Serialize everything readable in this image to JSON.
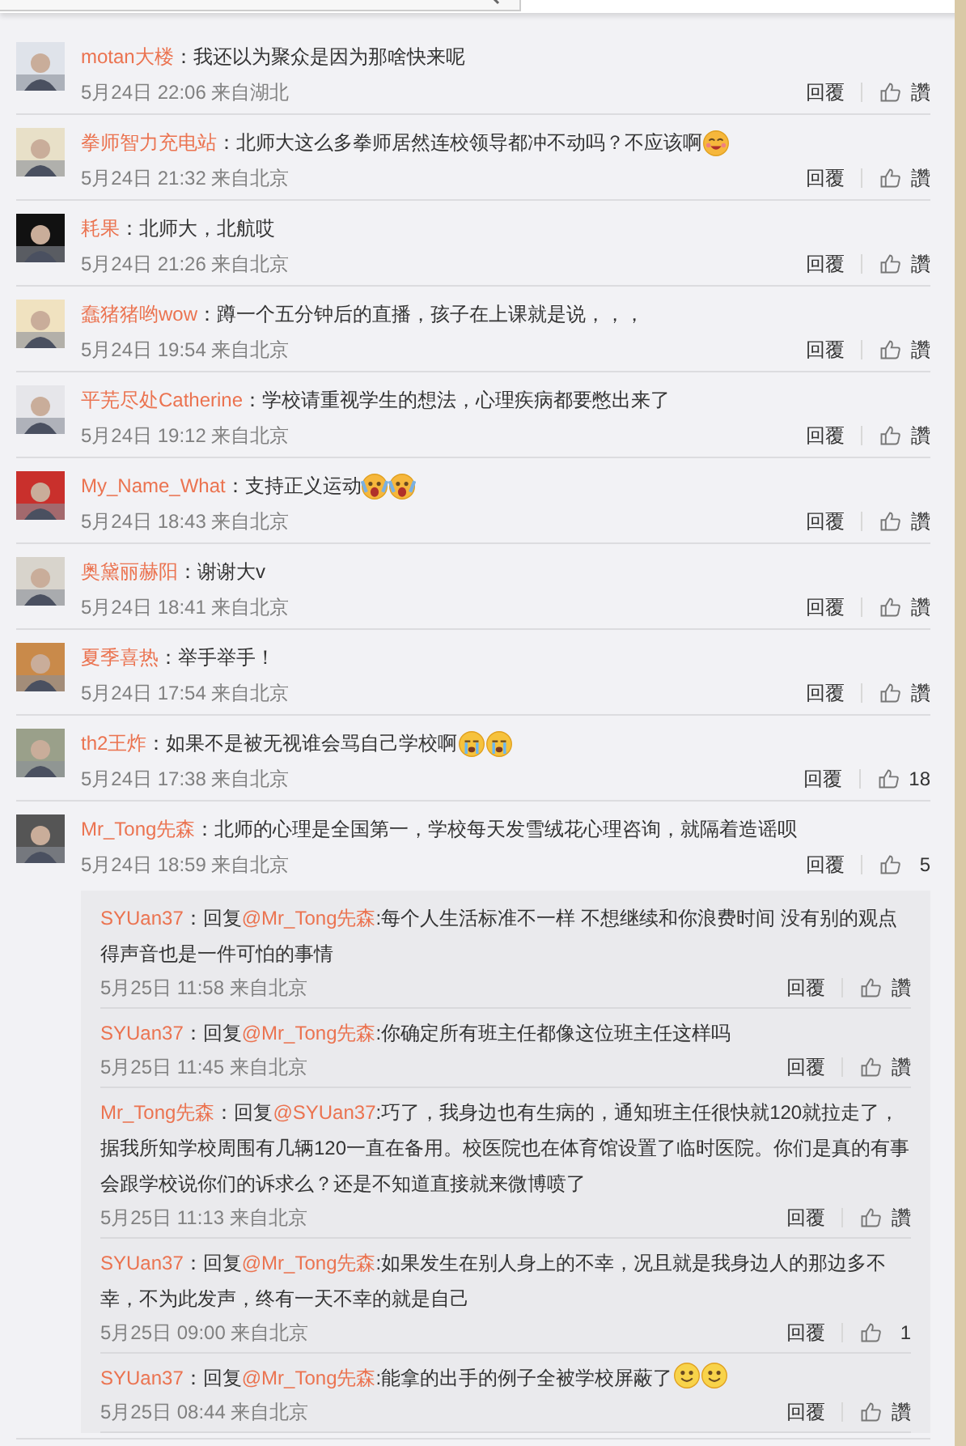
{
  "comments": [
    {
      "user": "motan大楼",
      "text": "：我还以为聚众是因为那啥快来呢",
      "time": "5月24日 22:06 来自湖北",
      "reply": "回覆",
      "like": "讚"
    },
    {
      "user": "拳师智力充电站",
      "text": "：北师大这么多拳师居然连校领导都冲不动吗？不应该啊",
      "emoji": [
        {
          "kind": "blush"
        }
      ],
      "time": "5月24日 21:32 来自北京",
      "reply": "回覆",
      "like": "讚"
    },
    {
      "user": "耗果",
      "text": "：北师大，北航哎",
      "time": "5月24日 21:26 来自北京",
      "reply": "回覆",
      "like": "讚"
    },
    {
      "user": "蠢猪猪哟wow",
      "text": "：蹲一个五分钟后的直播，孩子在上课就是说，，，",
      "time": "5月24日 19:54 来自北京",
      "reply": "回覆",
      "like": "讚"
    },
    {
      "user": "平芜尽处Catherine",
      "text": "：学校请重视学生的想法，心理疾病都要憋出来了",
      "time": "5月24日 19:12 来自北京",
      "reply": "回覆",
      "like": "讚"
    },
    {
      "user": "My_Name_What",
      "text": "：支持正义运动",
      "emoji": [
        {
          "kind": "scream"
        },
        {
          "kind": "scream"
        }
      ],
      "time": "5月24日 18:43 来自北京",
      "reply": "回覆",
      "like": "讚"
    },
    {
      "user": "奥黛丽赫阳",
      "text": "：谢谢大v",
      "time": "5月24日 18:41 来自北京",
      "reply": "回覆",
      "like": "讚"
    },
    {
      "user": "夏季喜热",
      "text": "：举手举手！",
      "time": "5月24日 17:54 来自北京",
      "reply": "回覆",
      "like": "讚"
    },
    {
      "user": "th2王炸",
      "text": "：如果不是被无视谁会骂自己学校啊",
      "emoji": [
        {
          "kind": "cry"
        },
        {
          "kind": "cry"
        }
      ],
      "time": "5月24日 17:38 来自北京",
      "reply": "回覆",
      "like": "18"
    },
    {
      "user": "Mr_Tong先森",
      "text": "：北师的心理是全国第一，学校每天发雪绒花心理咨询，就隔着造谣呗",
      "time": "5月24日 18:59 来自北京",
      "reply": "回覆",
      "like": "5",
      "replies": [
        {
          "user": "SYUan37",
          "prefix": "：回复",
          "target": "@Mr_Tong先森",
          "text": ":每个人生活标准不一样 不想继续和你浪费时间 没有别的观点得声音也是一件可怕的事情",
          "time": "5月25日 11:58 来自北京",
          "reply": "回覆",
          "like": "讚"
        },
        {
          "user": "SYUan37",
          "prefix": "：回复",
          "target": "@Mr_Tong先森",
          "text": ":你确定所有班主任都像这位班主任这样吗",
          "time": "5月25日 11:45 来自北京",
          "reply": "回覆",
          "like": "讚"
        },
        {
          "user": "Mr_Tong先森",
          "prefix": "：回复",
          "target": "@SYUan37",
          "text": ":巧了，我身边也有生病的，通知班主任很快就120就拉走了，据我所知学校周围有几辆120一直在备用。校医院也在体育馆设置了临时医院。你们是真的有事会跟学校说你们的诉求么？还是不知道直接就来微博喷了",
          "time": "5月25日 11:13 来自北京",
          "reply": "回覆",
          "like": "讚"
        },
        {
          "user": "SYUan37",
          "prefix": "：回复",
          "target": "@Mr_Tong先森",
          "text": ":如果发生在别人身上的不幸，况且就是我身边人的那边多不幸，不为此发声，终有一天不幸的就是自己",
          "time": "5月25日 09:00 来自北京",
          "reply": "回覆",
          "like": "1"
        },
        {
          "user": "SYUan37",
          "prefix": "：回复",
          "target": "@Mr_Tong先森",
          "text": ":能拿的出手的例子全被学校屏蔽了",
          "emoji": [
            {
              "kind": "smile"
            },
            {
              "kind": "smile"
            }
          ],
          "time": "5月25日 08:44 来自北京",
          "reply": "回覆",
          "like": "讚"
        }
      ]
    }
  ]
}
